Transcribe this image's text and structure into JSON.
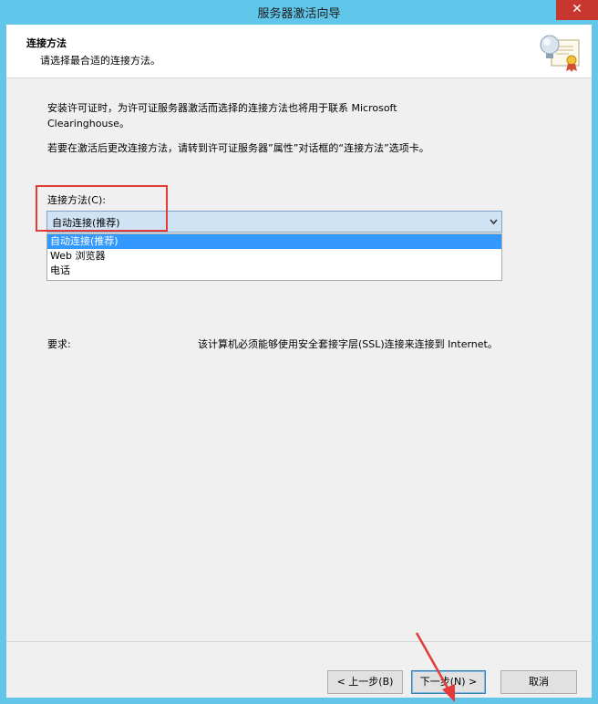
{
  "window": {
    "title": "服务器激活向导",
    "close_label": "✕"
  },
  "header": {
    "title": "连接方法",
    "subtitle": "请选择最合适的连接方法。",
    "icon": "certificate-icon"
  },
  "body": {
    "paragraph1": "安装许可证时，为许可证服务器激活而选择的连接方法也将用于联系 Microsoft Clearinghouse。",
    "paragraph2": "若要在激活后更改连接方法，请转到许可证服务器”属性”对话框的“连接方法”选项卡。"
  },
  "connection": {
    "label": "连接方法(C):",
    "selected_value": "自动连接(推荐)",
    "options": [
      "自动连接(推荐)",
      "Web 浏览器",
      "电话"
    ]
  },
  "requirements": {
    "label": "要求:",
    "value": "该计算机必须能够使用安全套接字层(SSL)连接来连接到 Internet。"
  },
  "buttons": {
    "back": "< 上一步(B)",
    "next": "下一步(N) >",
    "cancel": "取消"
  },
  "colors": {
    "title_bar": "#61c7ea",
    "close_button": "#c7372f",
    "selection": "#3399ff",
    "annotation": "#e33a3a"
  }
}
